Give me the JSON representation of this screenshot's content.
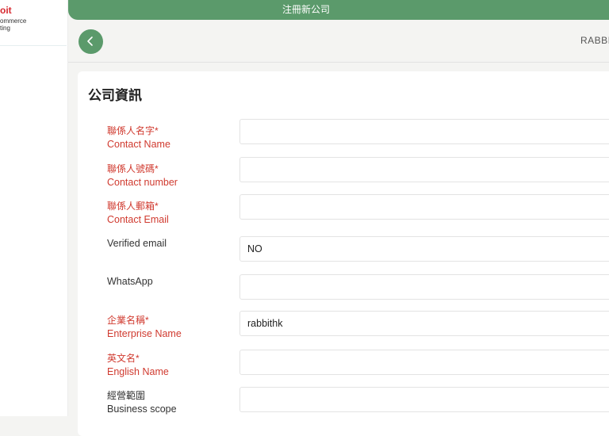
{
  "logo": {
    "line1": "oit",
    "line2": "ommerce",
    "line3": "ting"
  },
  "top_bar": {
    "title": "注冊新公司"
  },
  "header": {
    "brand": "RABBI"
  },
  "card": {
    "title": "公司資訊"
  },
  "form": {
    "fields": [
      {
        "label_zh": "聯係人名字*",
        "label_en": "Contact Name",
        "value": ""
      },
      {
        "label_zh": "聯係人號碼*",
        "label_en": "Contact number",
        "value": ""
      },
      {
        "label_zh": "聯係人郵箱*",
        "label_en": "Contact Email",
        "value": ""
      },
      {
        "label_zh": "",
        "label_en": "Verified email",
        "value": "NO"
      },
      {
        "label_zh": "",
        "label_en": "WhatsApp",
        "value": ""
      },
      {
        "label_zh": "企業名稱*",
        "label_en": "Enterprise Name",
        "value": "rabbithk"
      },
      {
        "label_zh": "英文名*",
        "label_en": "English Name",
        "value": ""
      },
      {
        "label_zh": "經營範圍",
        "label_en": "Business scope",
        "value": ""
      }
    ]
  },
  "colors": {
    "accent": "#5b9a6b",
    "required_label": "#d03a2f",
    "logo_red": "#d7282f"
  }
}
